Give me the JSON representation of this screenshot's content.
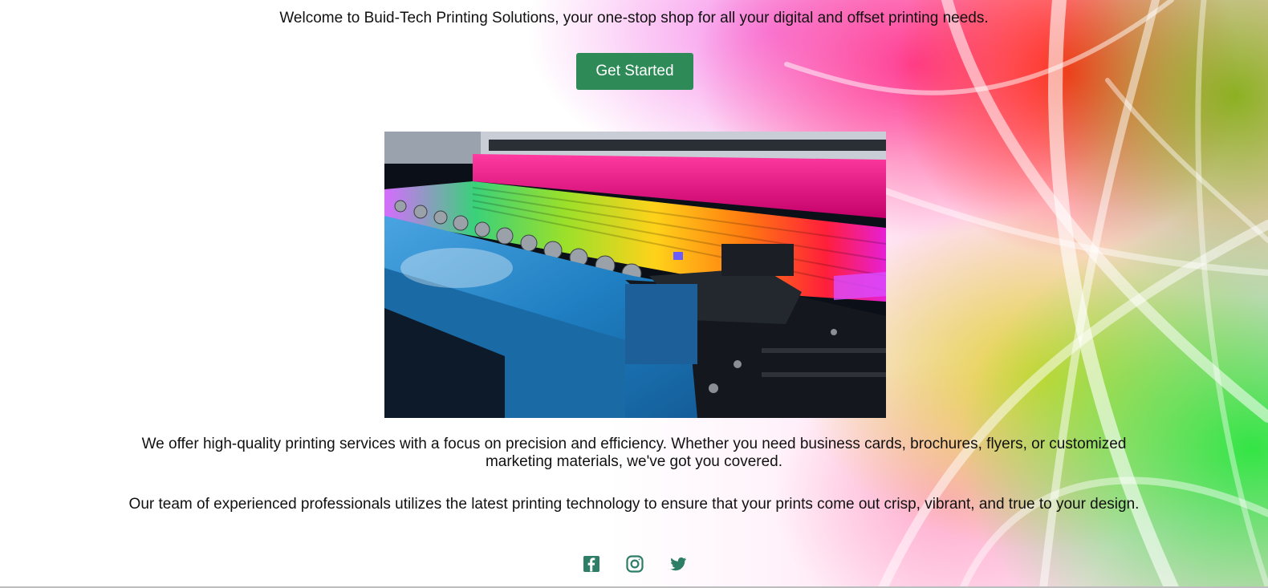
{
  "hero": {
    "welcome_text": "Welcome to Buid-Tech Printing Solutions, your one-stop shop for all your digital and offset printing needs.",
    "cta_label": "Get Started"
  },
  "about": {
    "paragraph_1": "We offer high-quality printing services with a focus on precision and efficiency. Whether you need business cards, brochures, flyers, or customized marketing materials, we've got you covered.",
    "paragraph_2": "Our team of experienced professionals utilizes the latest printing technology to ensure that your prints come out crisp, vibrant, and true to your design."
  },
  "social": {
    "icons": [
      "facebook-icon",
      "instagram-icon",
      "twitter-icon"
    ]
  },
  "colors": {
    "accent": "#2e8b57",
    "icon": "#2e7d66",
    "text": "#111111"
  }
}
